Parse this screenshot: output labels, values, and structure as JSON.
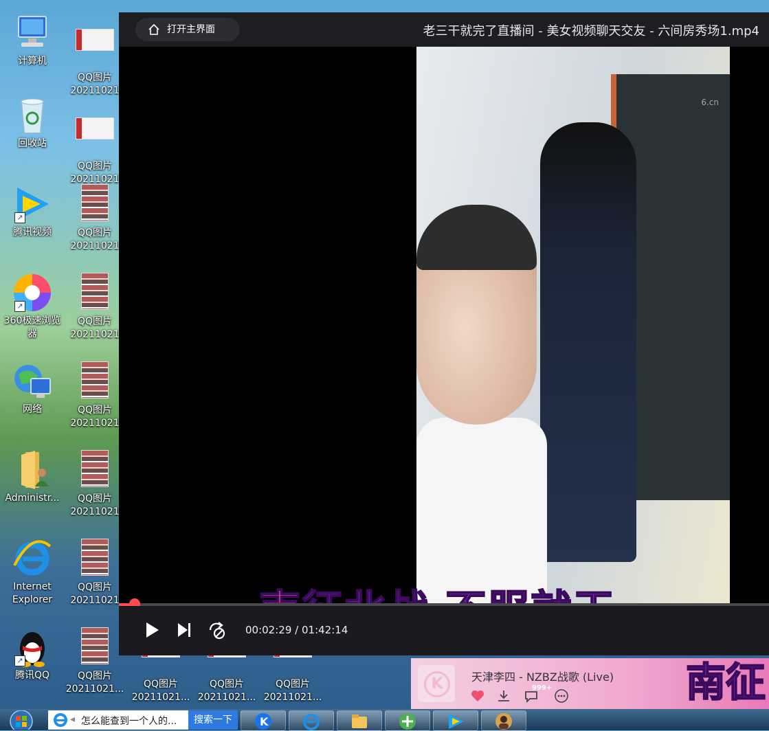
{
  "desktop": {
    "left_column": [
      {
        "label": "计算机",
        "icon": "computer-icon"
      },
      {
        "label": "回收站",
        "icon": "recycle-bin-icon"
      },
      {
        "label": "腾讯视频",
        "icon": "tencent-video-icon"
      },
      {
        "label": "360极速浏览器",
        "icon": "360-browser-icon"
      },
      {
        "label": "网络",
        "icon": "network-icon"
      },
      {
        "label": "Administr...",
        "icon": "user-folder-icon"
      },
      {
        "label": "Internet Explorer",
        "icon": "ie-icon"
      },
      {
        "label": "腾讯QQ",
        "icon": "qq-icon"
      }
    ],
    "qq_images": [
      {
        "label": "QQ图片 20211021"
      },
      {
        "label": "QQ图片 20211021"
      },
      {
        "label": "QQ图片 20211021"
      },
      {
        "label": "QQ图片 20211021"
      },
      {
        "label": "QQ图片 20211021"
      },
      {
        "label": "QQ图片 20211021"
      },
      {
        "label": "QQ图片 20211021"
      },
      {
        "label": "QQ图片 20211021..."
      },
      {
        "label": "QQ图片 20211021..."
      },
      {
        "label": "QQ图片 20211021..."
      },
      {
        "label": "QQ图片 20211021..."
      }
    ]
  },
  "player": {
    "home_button": "打开主界面",
    "title": "老三干就完了直播间 - 美女视频聊天交友 - 六间房秀场1.mp4",
    "watermark": "6.cn",
    "subtitle_first": "南",
    "subtitle_rest": "征北战  不服就干",
    "time_current": "00:02:29",
    "time_separator": "/",
    "time_total": "01:42:14",
    "progress": 0.0243
  },
  "music": {
    "cover_letter": "K",
    "song": "天津李四 - NZBZ战歌 (Live)",
    "comment_badge": "999+",
    "lyric_overflow": "南征"
  },
  "taskbar": {
    "search_text": "怎么能查到一个人的...",
    "search_button": "搜索一下",
    "apps": [
      "kugou-icon",
      "ie-icon",
      "explorer-folder-icon",
      "360-browser-icon",
      "tencent-video-icon",
      "qq-avatar-icon"
    ]
  }
}
